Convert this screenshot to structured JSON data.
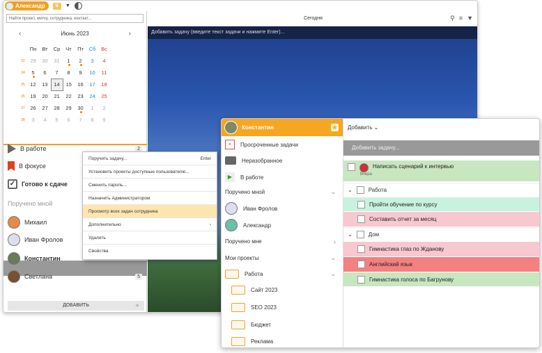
{
  "app": {
    "user": "Александр"
  },
  "left": {
    "search_placeholder": "Найти проект, метку, сотрудника, контакт...",
    "month": "Июнь 2023",
    "weekdays": [
      "Пн",
      "Вт",
      "Ср",
      "Чт",
      "Пт",
      "Сб",
      "Вс"
    ],
    "weeks": [
      {
        "n": "22",
        "d": [
          "29",
          "30",
          "31",
          "1",
          "2",
          "3",
          "4"
        ]
      },
      {
        "n": "24",
        "d": [
          "5",
          "6",
          "7",
          "8",
          "9",
          "10",
          "11"
        ]
      },
      {
        "n": "25",
        "d": [
          "12",
          "13",
          "14",
          "15",
          "16",
          "17",
          "18"
        ]
      },
      {
        "n": "26",
        "d": [
          "19",
          "20",
          "21",
          "22",
          "23",
          "24",
          "25"
        ]
      },
      {
        "n": "27",
        "d": [
          "26",
          "27",
          "28",
          "29",
          "30",
          "1",
          "2"
        ]
      },
      {
        "n": "28",
        "d": [
          "3",
          "4",
          "5",
          "6",
          "7",
          "8",
          "9"
        ]
      }
    ],
    "in_work": "В работе",
    "in_work_count": "2",
    "focus": "В фокусе",
    "ready": "Готово к сдаче",
    "assigned_by_me": "Поручено мной",
    "people": [
      {
        "name": "Михаил"
      },
      {
        "name": "Иван Фролов"
      },
      {
        "name": "Константин"
      },
      {
        "name": "Светлана",
        "count": "5"
      }
    ],
    "add_button": "ДОБАВИТЬ"
  },
  "main1": {
    "today": "Сегодня",
    "add_task": "Добавить задачу (введите текст задачи и нажмите Enter)..."
  },
  "context_menu": [
    {
      "label": "Поручить задачу...",
      "shortcut": "Enter"
    },
    {
      "label": "Установить проекты доступные пользователю...",
      "shortcut": ""
    },
    {
      "label": "Сменить пароль...",
      "shortcut": ""
    },
    {
      "label": "Назначить Администратором",
      "shortcut": ""
    },
    {
      "label": "Просмотр всех задач сотрудника",
      "shortcut": ""
    },
    {
      "label": "Дополнительно",
      "shortcut": "›"
    },
    {
      "label": "Удалить",
      "shortcut": ""
    },
    {
      "label": "Свойства",
      "shortcut": ""
    }
  ],
  "win2": {
    "user": "Константин",
    "items": {
      "overdue": "Просроченные задачи",
      "unsorted": "Неразобранное",
      "in_work": "В работе",
      "assigned_by_me": "Поручено мной",
      "ivan": "Иван Фролов",
      "alex": "Александр",
      "assigned_to_me": "Поручено мне",
      "my_projects": "Мои проекты",
      "work": "Работа",
      "site": "Сайт 2023",
      "seo": "SEO 2023",
      "budget": "Бюджет",
      "ads": "Реклама"
    },
    "add_menu": "Добавить",
    "add_task": "Добавить задачу...",
    "task1": "Написать сценарий к интервью",
    "task1_date": "Вчера",
    "group_work": "Работа",
    "task2": "Пройти обучение по курсу",
    "task3": "Составить отчет за месяц",
    "group_home": "Дом",
    "task4": "Гимнастика глаз по Жданову",
    "task5": "Английский язык",
    "task6": "Гимнастика голоса по Багрунову"
  },
  "colors": {
    "accent": "#f5a623",
    "green_task": "#c8e6c0",
    "mint_task": "#c8f2e0",
    "pink_task": "#f8c8d0",
    "red_task": "#f48080"
  }
}
